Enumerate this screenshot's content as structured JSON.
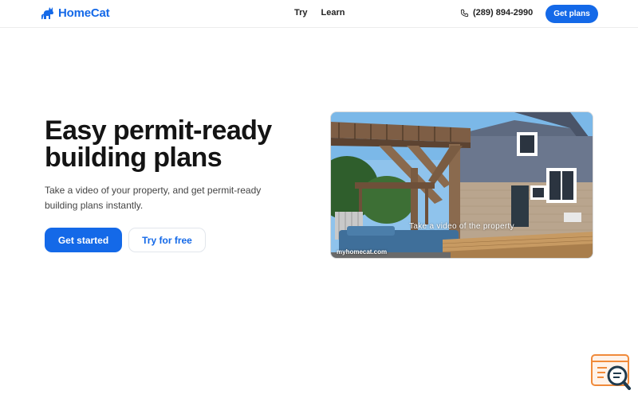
{
  "brand": {
    "name": "HomeCat",
    "color": "#1469e8"
  },
  "nav": {
    "links": [
      "Try",
      "Learn"
    ],
    "phone": "(289) 894-2990",
    "cta_label": "Get plans"
  },
  "hero": {
    "title_line1": "Easy permit-ready",
    "title_line2": "building plans",
    "subtitle": "Take a video of your property, and get permit-ready building plans instantly.",
    "primary_label": "Get started",
    "secondary_label": "Try for free"
  },
  "video": {
    "caption": "Take a video of the property",
    "watermark": "myhomecat.com"
  },
  "widget": {
    "icon": "search-chat-icon",
    "accent": "#f08a3a"
  }
}
